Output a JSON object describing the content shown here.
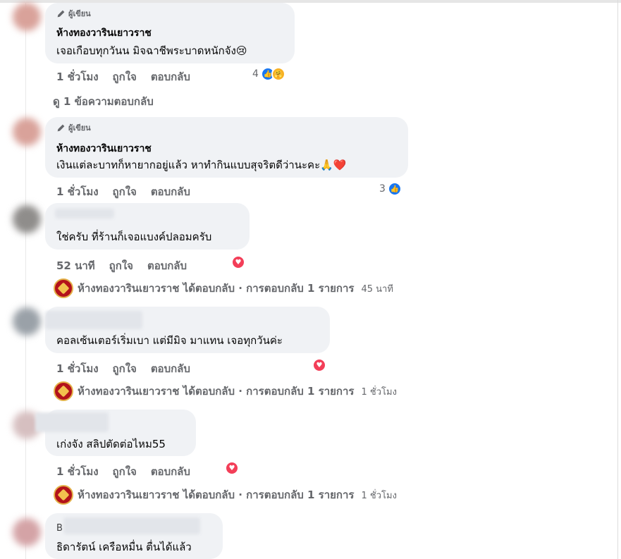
{
  "author_badge_label": "ผู้เขียน",
  "page_name": "ห้างทองวารินเยาวราช",
  "actions": {
    "like": "ถูกใจ",
    "reply": "ตอบกลับ"
  },
  "comment1": {
    "text": "เจอเกือบทุกวันน มิจฉาชีพระบาดหนักจัง😢",
    "time": "1 ชั่วโมง",
    "reaction_count": "4",
    "reactions": [
      "like-icon",
      "care-icon"
    ]
  },
  "view_replies": "ดู 1 ข้อความตอบกลับ",
  "comment2": {
    "text": "เงินแต่ละบาทก็หายากอยู่แล้ว หาทำกินแบบสุจริตดีว่านะคะ🙏❤️",
    "time": "1 ชั่วโมง",
    "reaction_count": "3",
    "reactions": [
      "like-icon"
    ]
  },
  "comment3": {
    "text": "ใช่ครับ ที่ร้านก็เจอแบงค์ปลอมครับ",
    "time": "52 นาที",
    "reactions": [
      "love-icon"
    ],
    "reply_summary": "ห้างทองวารินเยาวราช ได้ตอบกลับ · การตอบกลับ 1 รายการ",
    "reply_time": "45 นาที"
  },
  "comment4": {
    "text": "คอลเซ้นเตอร์เริ่มเบา แต่มีมิจ มาแทน เจอทุกวันค่ะ",
    "time": "1 ชั่วโมง",
    "reactions": [
      "love-icon"
    ],
    "reply_summary": "ห้างทองวารินเยาวราช ได้ตอบกลับ · การตอบกลับ 1 รายการ",
    "reply_time": "1 ชั่วโมง"
  },
  "comment5": {
    "text": "เก่งจัง สลิปตัดต่อไหม55",
    "time": "1 ชั่วโมง",
    "reactions": [
      "love-icon"
    ],
    "reply_summary": "ห้างทองวารินเยาวราช ได้ตอบกลับ · การตอบกลับ 1 รายการ",
    "reply_time": "1 ชั่วโมง"
  },
  "comment6": {
    "name_prefix": "B",
    "text": "ธิดารัตน์ เครือหมื่น ตื่นได้แล้ว"
  },
  "colors": {
    "bubble": "#f0f2f5",
    "secondary_text": "#65676b",
    "like": "#1877f2",
    "love": "#f33e58"
  }
}
